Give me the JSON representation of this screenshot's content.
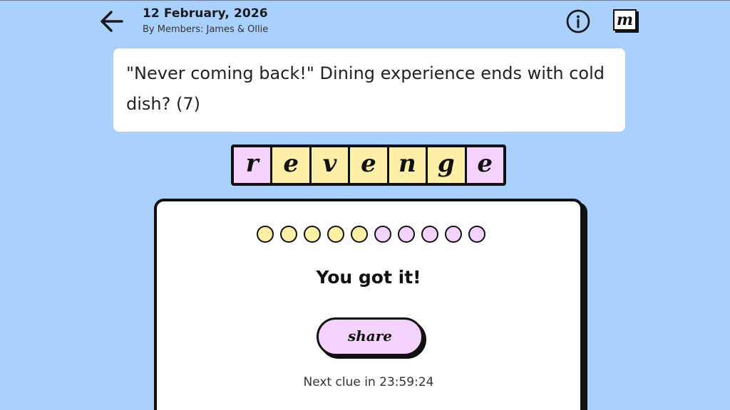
{
  "header": {
    "date": "12 February, 2026",
    "byline": "By Members: James & Ollie",
    "logo_letter": "m",
    "icons": {
      "back": "arrow-left-icon",
      "info": "info-icon",
      "logo": "logo-icon"
    }
  },
  "clue": {
    "text": "\"Never coming back!\" Dining experience ends with cold dish? (7)"
  },
  "answer": {
    "letters": [
      "r",
      "e",
      "v",
      "e",
      "n",
      "g",
      "e"
    ],
    "tile_colors": [
      "pink",
      "yellow",
      "yellow",
      "yellow",
      "yellow",
      "yellow",
      "pink"
    ]
  },
  "result": {
    "progress_dots": [
      "yellow",
      "yellow",
      "yellow",
      "yellow",
      "yellow",
      "pink",
      "pink",
      "pink",
      "pink",
      "pink"
    ],
    "title": "You got it!",
    "share_label": "share",
    "next_clue": "Next clue in 23:59:24"
  },
  "colors": {
    "background": "#aad1fd",
    "pink": "#f3d2fc",
    "yellow": "#fdefa6",
    "ink": "#111111"
  }
}
